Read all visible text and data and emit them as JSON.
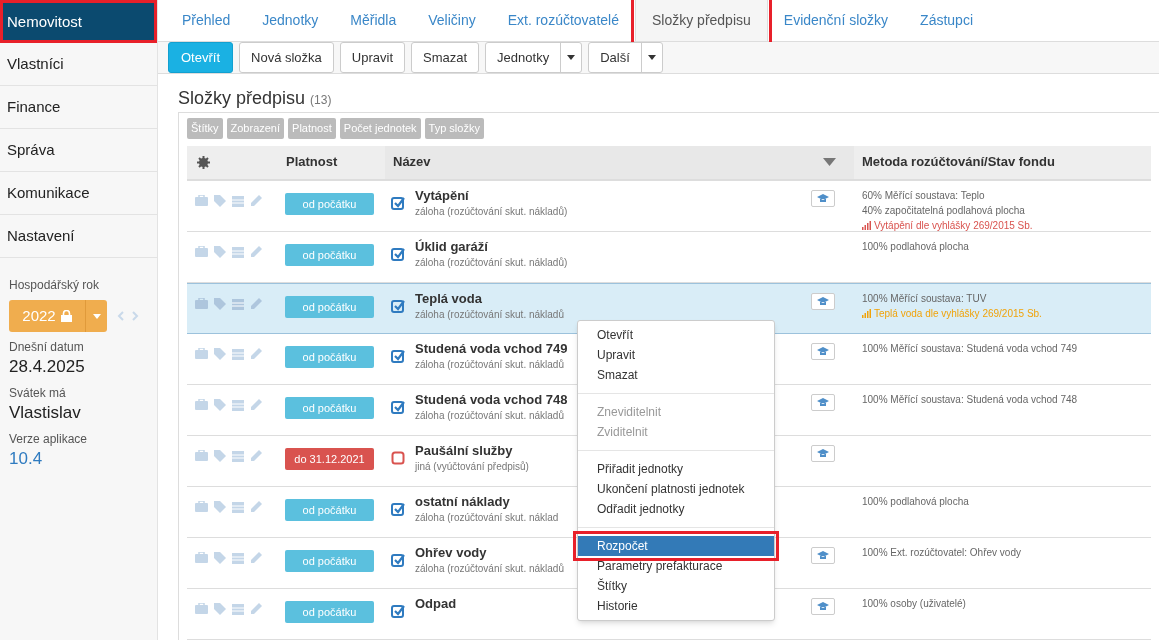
{
  "sidebar": {
    "items": [
      {
        "label": "Nemovitost",
        "selected": true,
        "highlighted": true
      },
      {
        "label": "Vlastníci",
        "selected": false,
        "highlighted": false
      },
      {
        "label": "Finance",
        "selected": false,
        "highlighted": false
      },
      {
        "label": "Správa",
        "selected": false,
        "highlighted": false
      },
      {
        "label": "Komunikace",
        "selected": false,
        "highlighted": false
      },
      {
        "label": "Nastavení",
        "selected": false,
        "highlighted": false
      }
    ],
    "fiscal_year": {
      "label": "Hospodářský rok",
      "value": "2022",
      "locked": true
    },
    "info": [
      {
        "label": "Dnešní datum",
        "value": "28.4.2025",
        "kind": "plain"
      },
      {
        "label": "Svátek má",
        "value": "Vlastislav",
        "kind": "plain"
      },
      {
        "label": "Verze aplikace",
        "value": "10.4",
        "kind": "link"
      }
    ]
  },
  "tabs": [
    {
      "label": "Přehled",
      "selected": false,
      "highlighted": false
    },
    {
      "label": "Jednotky",
      "selected": false,
      "highlighted": false
    },
    {
      "label": "Měřidla",
      "selected": false,
      "highlighted": false
    },
    {
      "label": "Veličiny",
      "selected": false,
      "highlighted": false
    },
    {
      "label": "Ext. rozúčtovatelé",
      "selected": false,
      "highlighted": false
    },
    {
      "label": "Složky předpisu",
      "selected": true,
      "highlighted": true
    },
    {
      "label": "Evidenční složky",
      "selected": false,
      "highlighted": false
    },
    {
      "label": "Zástupci",
      "selected": false,
      "highlighted": false
    }
  ],
  "toolbar": [
    {
      "label": "Otevřít",
      "kind": "primary"
    },
    {
      "label": "Nová složka",
      "kind": "plain"
    },
    {
      "label": "Upravit",
      "kind": "plain"
    },
    {
      "label": "Smazat",
      "kind": "plain"
    },
    {
      "label": "Jednotky",
      "kind": "split"
    },
    {
      "label": "Další",
      "kind": "split"
    }
  ],
  "heading": {
    "title": "Složky předpisu",
    "count": "(13)"
  },
  "filter_tags": [
    "Štítky",
    "Zobrazení",
    "Platnost",
    "Počet jednotek",
    "Typ složky"
  ],
  "table": {
    "columns": [
      "Platnost",
      "Název",
      "Metoda rozúčtování/Stav fondu"
    ],
    "rows": [
      {
        "validity": {
          "text": "od počátku",
          "color": "#5bc0de"
        },
        "checked": true,
        "name": "Vytápění",
        "type": "záloha (rozúčtování skut. nákladů)",
        "selected": false,
        "method_button": true,
        "method": [
          {
            "text": "60% Měřící soustava: Teplo",
            "kind": "plain"
          },
          {
            "text": "40% započitatelná podlahová plocha",
            "kind": "plain"
          },
          {
            "text": "Vytápění dle vyhlášky 269/2015 Sb.",
            "kind": "alert"
          }
        ]
      },
      {
        "validity": {
          "text": "od počátku",
          "color": "#5bc0de"
        },
        "checked": true,
        "name": "Úklid garáží",
        "type": "záloha (rozúčtování skut. nákladů)",
        "selected": false,
        "method_button": false,
        "method": [
          {
            "text": "100% podlahová plocha",
            "kind": "plain"
          }
        ]
      },
      {
        "validity": {
          "text": "od počátku",
          "color": "#5bc0de"
        },
        "checked": true,
        "name": "Teplá voda",
        "type": "záloha (rozúčtování skut. nákladů",
        "selected": true,
        "method_button": true,
        "method": [
          {
            "text": "100% Měřící soustava: TUV",
            "kind": "plain"
          },
          {
            "text": "Teplá voda dle vyhlášky 269/2015 Sb.",
            "kind": "warning"
          }
        ]
      },
      {
        "validity": {
          "text": "od počátku",
          "color": "#5bc0de"
        },
        "checked": true,
        "name": "Studená voda vchod 749",
        "type": "záloha (rozúčtování skut. nákladů",
        "selected": false,
        "method_button": true,
        "method": [
          {
            "text": "100% Měřící soustava: Studená voda vchod 749",
            "kind": "plain"
          }
        ]
      },
      {
        "validity": {
          "text": "od počátku",
          "color": "#5bc0de"
        },
        "checked": true,
        "name": "Studená voda vchod 748",
        "type": "záloha (rozúčtování skut. nákladů",
        "selected": false,
        "method_button": true,
        "method": [
          {
            "text": "100% Měřící soustava: Studená voda vchod 748",
            "kind": "plain"
          }
        ]
      },
      {
        "validity": {
          "text": "do 31.12.2021",
          "color": "#d9534f"
        },
        "checked": false,
        "name": "Paušální služby",
        "type": "jiná (vyúčtování předpisů)",
        "selected": false,
        "method_button": true,
        "method": []
      },
      {
        "validity": {
          "text": "od počátku",
          "color": "#5bc0de"
        },
        "checked": true,
        "name": "ostatní náklady",
        "type": "záloha (rozúčtování skut. náklad",
        "selected": false,
        "method_button": false,
        "method": [
          {
            "text": "100% podlahová plocha",
            "kind": "plain"
          }
        ]
      },
      {
        "validity": {
          "text": "od počátku",
          "color": "#5bc0de"
        },
        "checked": true,
        "name": "Ohřev vody",
        "type": "záloha (rozúčtování skut. nákladů",
        "selected": false,
        "method_button": true,
        "method": [
          {
            "text": "100% Ext. rozúčtovatel: Ohřev vody",
            "kind": "plain"
          }
        ]
      },
      {
        "validity": {
          "text": "od počátku",
          "color": "#5bc0de"
        },
        "checked": true,
        "name": "Odpad",
        "selected": false,
        "method_button": true,
        "method": [
          {
            "text": "100% osoby (uživatelé)",
            "kind": "plain"
          }
        ]
      }
    ]
  },
  "context_menu": {
    "groups": [
      [
        {
          "label": "Otevřít",
          "disabled": false,
          "selected": false,
          "highlighted": false
        },
        {
          "label": "Upravit",
          "disabled": false,
          "selected": false,
          "highlighted": false
        },
        {
          "label": "Smazat",
          "disabled": false,
          "selected": false,
          "highlighted": false
        }
      ],
      [
        {
          "label": "Zneviditelnit",
          "disabled": true,
          "selected": false,
          "highlighted": false
        },
        {
          "label": "Zviditelnit",
          "disabled": true,
          "selected": false,
          "highlighted": false
        }
      ],
      [
        {
          "label": "Přiřadit jednotky",
          "disabled": false,
          "selected": false,
          "highlighted": false
        },
        {
          "label": "Ukončení platnosti jednotek",
          "disabled": false,
          "selected": false,
          "highlighted": false
        },
        {
          "label": "Odřadit jednotky",
          "disabled": false,
          "selected": false,
          "highlighted": false
        }
      ],
      [
        {
          "label": "Rozpočet",
          "disabled": false,
          "selected": true,
          "highlighted": true
        },
        {
          "label": "Parametry prefakturace",
          "disabled": false,
          "selected": false,
          "highlighted": false
        },
        {
          "label": "Štítky",
          "disabled": false,
          "selected": false,
          "highlighted": false
        },
        {
          "label": "Historie",
          "disabled": false,
          "selected": false,
          "highlighted": false
        }
      ]
    ]
  }
}
